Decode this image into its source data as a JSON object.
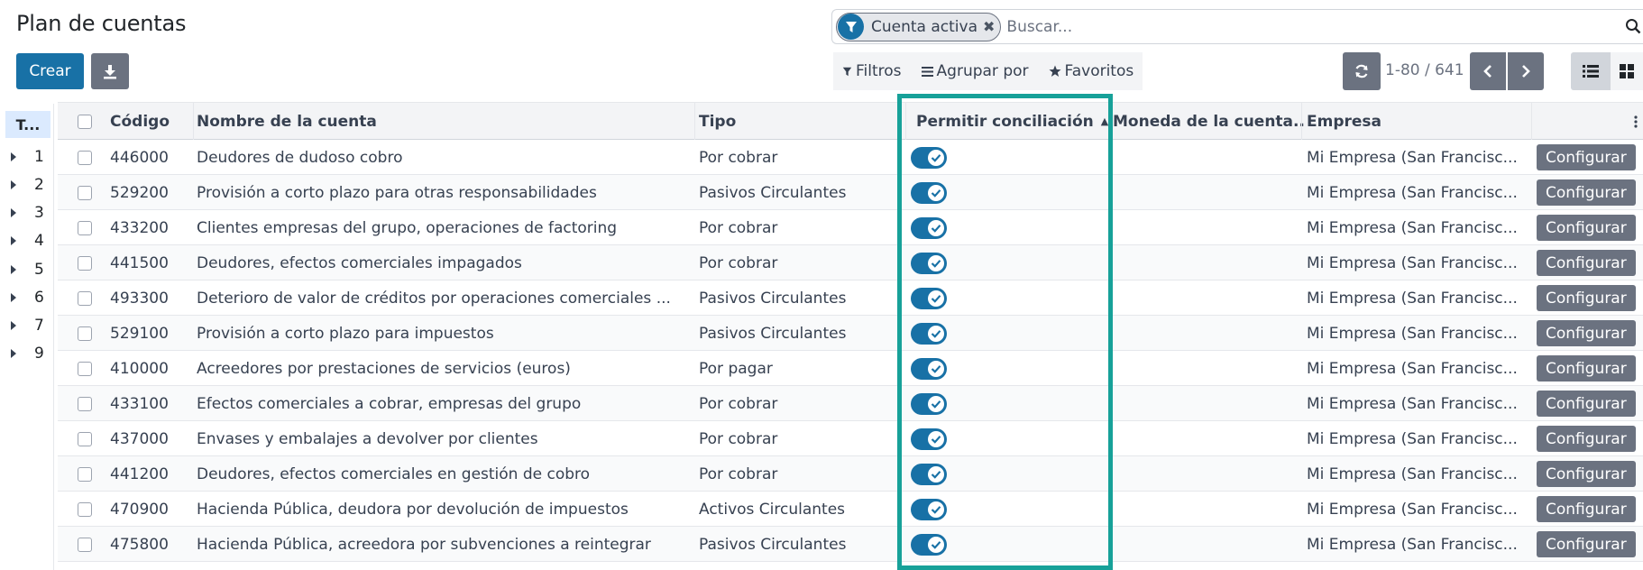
{
  "page": {
    "title": "Plan de cuentas",
    "create_label": "Crear",
    "download_icon": "download-icon"
  },
  "search": {
    "facet_icon": "filter-icon",
    "facet_label": "Cuenta activa",
    "facet_remove": "✖",
    "placeholder": "Buscar...",
    "search_icon": "search-icon"
  },
  "filters": {
    "filters_label": "Filtros",
    "groupby_label": "Agrupar por",
    "favorites_label": "Favoritos"
  },
  "pager": {
    "value": "1-80 / 641"
  },
  "side_panel": {
    "header": "T...",
    "items": [
      "1",
      "2",
      "3",
      "4",
      "5",
      "6",
      "7",
      "9"
    ]
  },
  "table": {
    "columns": {
      "code": "Código",
      "name": "Nombre de la cuenta",
      "type": "Tipo",
      "reconcile": "Permitir conciliación",
      "currency": "Moneda de la cuenta...",
      "company": "Empresa"
    },
    "sort_indicator": "▲",
    "configure_label": "Configurar",
    "rows": [
      {
        "code": "446000",
        "name": "Deudores de dudoso cobro",
        "type": "Por cobrar",
        "reconcile": true,
        "currency": "",
        "company": "Mi Empresa (San Francisc..."
      },
      {
        "code": "529200",
        "name": "Provisión a corto plazo para otras responsabilidades",
        "type": "Pasivos Circulantes",
        "reconcile": true,
        "currency": "",
        "company": "Mi Empresa (San Francisc..."
      },
      {
        "code": "433200",
        "name": "Clientes empresas del grupo, operaciones de factoring",
        "type": "Por cobrar",
        "reconcile": true,
        "currency": "",
        "company": "Mi Empresa (San Francisc..."
      },
      {
        "code": "441500",
        "name": "Deudores, efectos comerciales impagados",
        "type": "Por cobrar",
        "reconcile": true,
        "currency": "",
        "company": "Mi Empresa (San Francisc..."
      },
      {
        "code": "493300",
        "name": "Deterioro de valor de créditos por operaciones comerciales ...",
        "type": "Pasivos Circulantes",
        "reconcile": true,
        "currency": "",
        "company": "Mi Empresa (San Francisc..."
      },
      {
        "code": "529100",
        "name": "Provisión a corto plazo para impuestos",
        "type": "Pasivos Circulantes",
        "reconcile": true,
        "currency": "",
        "company": "Mi Empresa (San Francisc..."
      },
      {
        "code": "410000",
        "name": "Acreedores por prestaciones de servicios (euros)",
        "type": "Por pagar",
        "reconcile": true,
        "currency": "",
        "company": "Mi Empresa (San Francisc..."
      },
      {
        "code": "433100",
        "name": "Efectos comerciales a cobrar, empresas del grupo",
        "type": "Por cobrar",
        "reconcile": true,
        "currency": "",
        "company": "Mi Empresa (San Francisc..."
      },
      {
        "code": "437000",
        "name": "Envases y embalajes a devolver por clientes",
        "type": "Por cobrar",
        "reconcile": true,
        "currency": "",
        "company": "Mi Empresa (San Francisc..."
      },
      {
        "code": "441200",
        "name": "Deudores, efectos comerciales en gestión de cobro",
        "type": "Por cobrar",
        "reconcile": true,
        "currency": "",
        "company": "Mi Empresa (San Francisc..."
      },
      {
        "code": "470900",
        "name": "Hacienda Pública, deudora por devolución de impuestos",
        "type": "Activos Circulantes",
        "reconcile": true,
        "currency": "",
        "company": "Mi Empresa (San Francisc..."
      },
      {
        "code": "475800",
        "name": "Hacienda Pública, acreedora por subvenciones a reintegrar",
        "type": "Pasivos Circulantes",
        "reconcile": true,
        "currency": "",
        "company": "Mi Empresa (San Francisc..."
      }
    ]
  },
  "colors": {
    "primary": "#1871a6",
    "secondary_button": "#6b7280",
    "highlight_box": "#17a199"
  }
}
